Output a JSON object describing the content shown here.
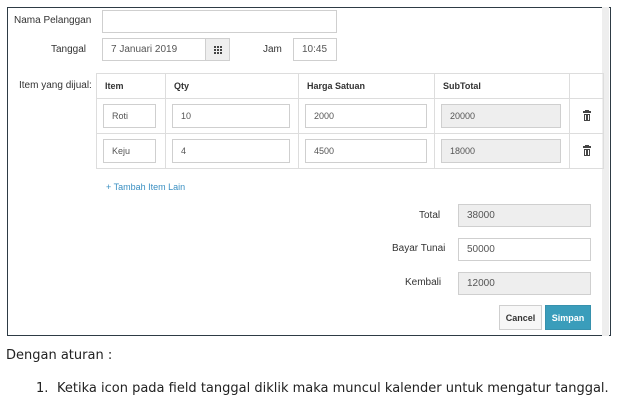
{
  "form": {
    "customer_label": "Nama Pelanggan",
    "customer_value": "",
    "date_label": "Tanggal",
    "date_value": "7 Januari 2019",
    "time_label": "Jam",
    "time_value": "10:45",
    "items_label": "Item yang dijual:"
  },
  "table": {
    "headers": [
      "Item",
      "Qty",
      "Harga Satuan",
      "SubTotal",
      ""
    ],
    "rows": [
      {
        "item": "Roti",
        "qty": "10",
        "price": "2000",
        "subtotal": "20000"
      },
      {
        "item": "Keju",
        "qty": "4",
        "price": "4500",
        "subtotal": "18000"
      }
    ]
  },
  "add_item_label": "+ Tambah Item Lain",
  "summary": {
    "total_label": "Total",
    "total_value": "38000",
    "cash_label": "Bayar Tunai",
    "cash_value": "50000",
    "change_label": "Kembali",
    "change_value": "12000"
  },
  "buttons": {
    "cancel": "Cancel",
    "save": "Simpan"
  },
  "icons": {
    "calendar": "calendar-grid-icon",
    "delete": "trash-icon"
  },
  "colors": {
    "primary": "#3a9dbb",
    "link": "#3a8fc2",
    "readonly_bg": "#eeeeee"
  },
  "notes": {
    "heading": "Dengan aturan :",
    "rules": [
      "Ketika icon pada field tanggal diklik maka muncul kalender untuk mengatur tanggal."
    ]
  }
}
